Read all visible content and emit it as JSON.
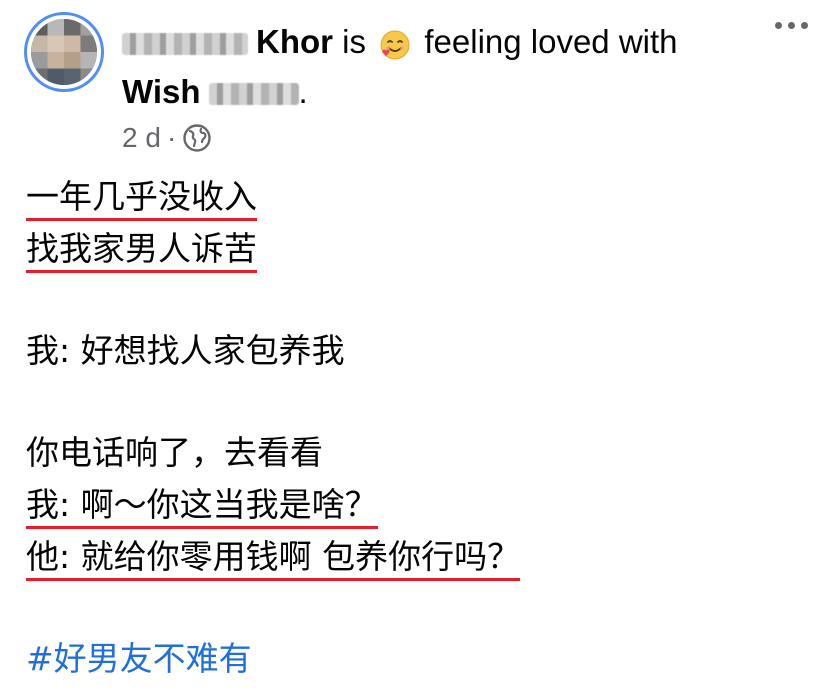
{
  "header": {
    "author_surname": "Khor",
    "is_text": "is",
    "feeling_text": "feeling loved with",
    "tagged_first_name": "Wish",
    "period": ".",
    "emoji": "smiling-face-with-hearts-icon"
  },
  "meta": {
    "time": "2 d",
    "separator": "·",
    "privacy_icon": "globe-icon"
  },
  "body": {
    "lines": [
      "一年几乎没收入",
      "找我家男人诉苦",
      "我: 好想找人家包养我",
      "你电话响了，去看看",
      "我: 啊～你这当我是啥？",
      "他: 就给你零用钱啊 包养你行吗？"
    ],
    "hashtag": "#好男友不难有"
  },
  "colors": {
    "avatar_ring": "#4f8ff7",
    "underline": "#e41e2b",
    "hashtag": "#216fdb",
    "meta_text": "#65676b"
  }
}
